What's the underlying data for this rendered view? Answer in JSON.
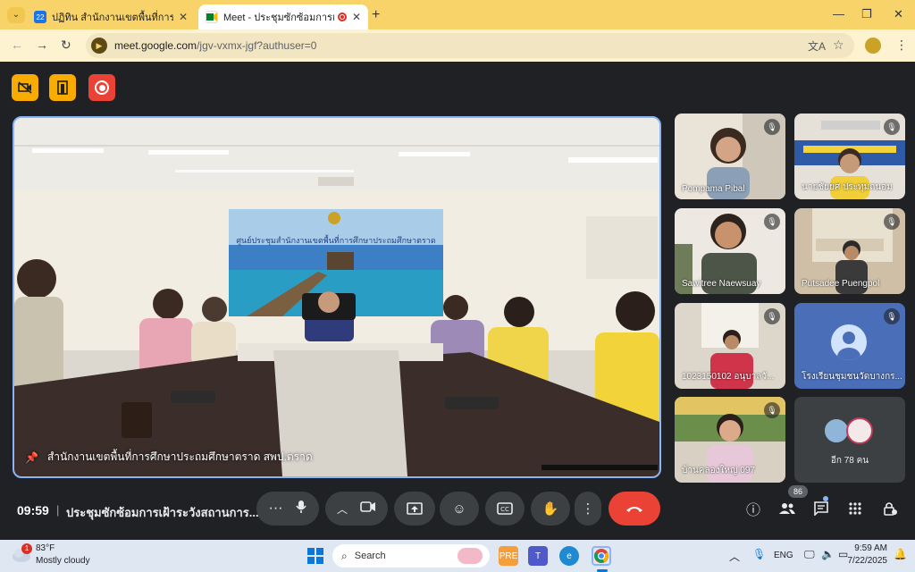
{
  "browser": {
    "tabs": [
      {
        "title": "ปฏิทิน สำนักงานเขตพื้นที่การศึกษาป",
        "icon": "calendar-icon",
        "favicon_text": "22"
      },
      {
        "title": "Meet - ประชุมซักซ้อมการเฝ้าระ",
        "icon": "meet-icon",
        "active": true
      }
    ],
    "url_host": "meet.google.com",
    "url_path": "/jgv-vxmx-jgf?authuser=0"
  },
  "main_video": {
    "banner_text": "ศูนย์ประชุมสำนักงานเขตพื้นที่การศึกษาประถมศึกษาตราด",
    "caption": "สำนักงานเขตพื้นที่การศึกษาประถมศึกษาตราด สพป.ตราด"
  },
  "participants": [
    {
      "name": "Pompama Pibal",
      "muted": true
    },
    {
      "name": "นายชัยยศ ประทุมถนอม",
      "muted": true
    },
    {
      "name": "Sawitree Naewsuay",
      "muted": true
    },
    {
      "name": "Putsadee Puengpol",
      "muted": true
    },
    {
      "name": "1023150102 อนุบาลวั...",
      "muted": true
    },
    {
      "name": "โรงเรียนชุมชนวัดบางกร...",
      "muted": true
    },
    {
      "name": "บ้านคลองใหญ่ 097",
      "muted": true
    }
  ],
  "others": {
    "label": "อีก 78 คน"
  },
  "bottom_bar": {
    "time": "09:59",
    "separator": "|",
    "meeting_title": "ประชุมซักซ้อมการเฝ้าระวังสถานการ...",
    "participant_count": "86"
  },
  "taskbar": {
    "weather_temp": "83°F",
    "weather_desc": "Mostly cloudy",
    "weather_badge": "1",
    "search_placeholder": "Search",
    "lang": "ENG",
    "clock_time": "9:59 AM",
    "clock_date": "7/22/2025"
  },
  "colors": {
    "tabstrip": "#f7d36a",
    "meet_bg": "#202124",
    "active_speaker_border": "#8ab4f8",
    "end_call": "#ea4335",
    "host_control": "#f9ab00"
  }
}
